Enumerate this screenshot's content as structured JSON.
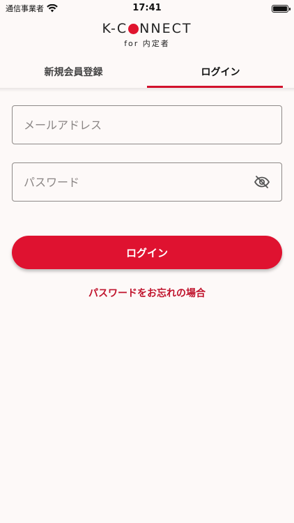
{
  "status_bar": {
    "carrier": "通信事業者",
    "time": "17:41"
  },
  "logo": {
    "left": "K-C",
    "right": "NNECT",
    "subtitle": "for 内定者"
  },
  "tabs": [
    {
      "label": "新規会員登録",
      "active": false
    },
    {
      "label": "ログイン",
      "active": true
    }
  ],
  "form": {
    "email_placeholder": "メールアドレス",
    "password_placeholder": "パスワード",
    "login_button": "ログイン",
    "forgot_password": "パスワードをお忘れの場合"
  },
  "colors": {
    "accent": "#df1230",
    "background": "#fdf9f8"
  }
}
